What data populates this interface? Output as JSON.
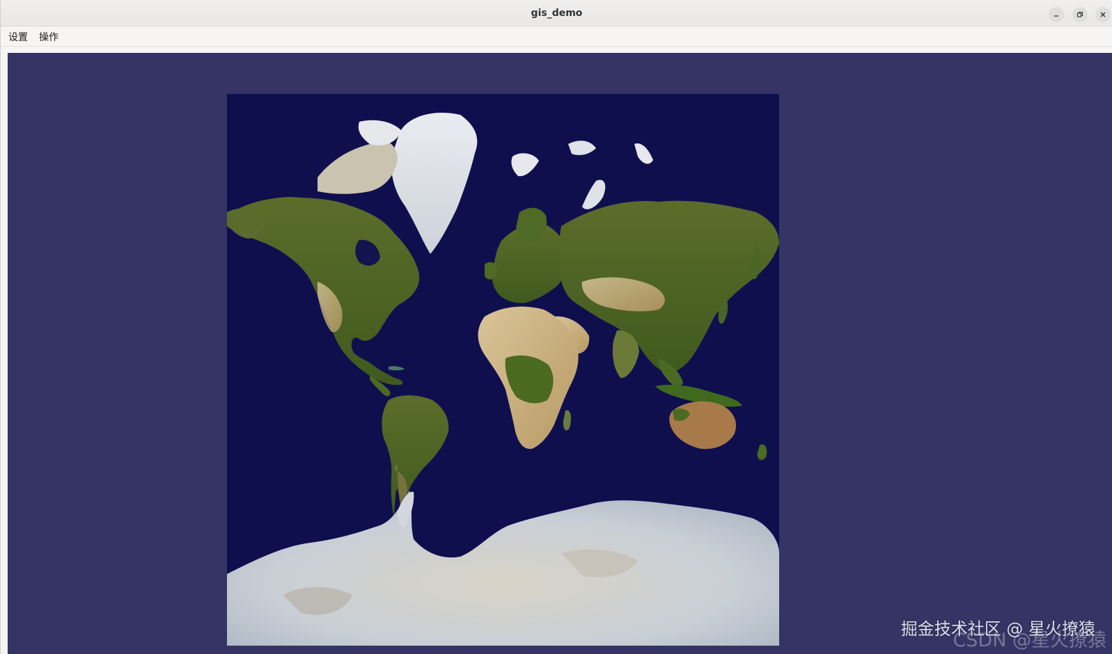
{
  "window": {
    "title": "gis_demo"
  },
  "menubar": {
    "items": [
      {
        "label": "设置"
      },
      {
        "label": "操作"
      }
    ]
  },
  "window_controls": {
    "minimize_icon": "minimize-icon",
    "maximize_icon": "restore-icon",
    "close_icon": "close-icon"
  },
  "map": {
    "background_color": "#353465",
    "ocean_color": "#0f0f4e",
    "content": "world satellite imagery, Web Mercator projection"
  },
  "watermarks": {
    "primary": "掘金技术社区 @ 星火撩猿",
    "secondary": "CSDN @星火撩猿"
  }
}
